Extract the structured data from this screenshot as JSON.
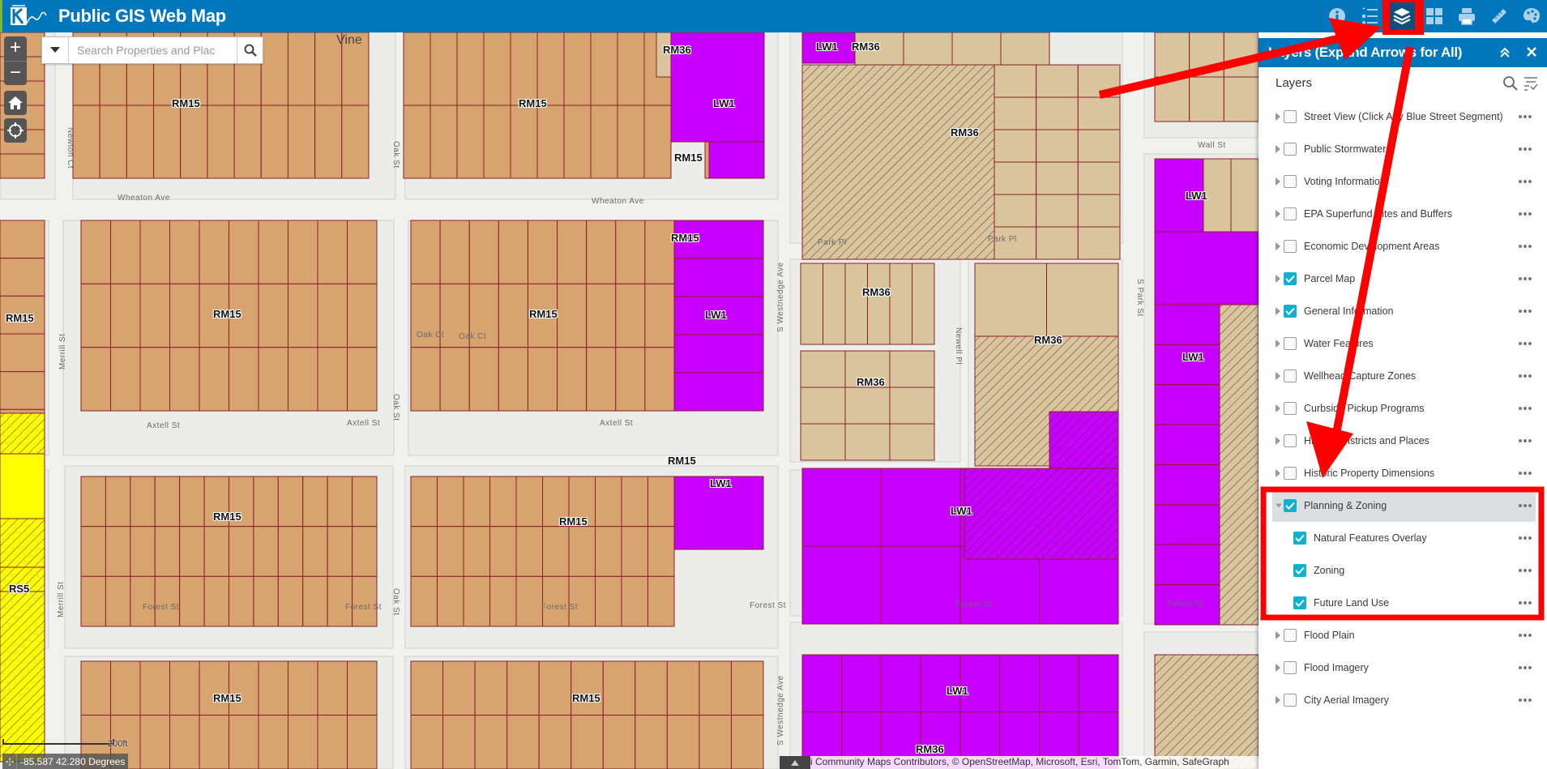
{
  "header": {
    "app_title": "Public GIS Web Map",
    "logo": "city-logo",
    "tools": [
      {
        "name": "info",
        "icon": "info-icon",
        "active": false
      },
      {
        "name": "legend",
        "icon": "legend-list-icon",
        "active": false
      },
      {
        "name": "layers",
        "icon": "layers-icon",
        "active": true
      },
      {
        "name": "basemap-gallery",
        "icon": "grid-icon",
        "active": false
      },
      {
        "name": "print",
        "icon": "printer-icon",
        "active": false
      },
      {
        "name": "measure",
        "icon": "ruler-icon",
        "active": false
      },
      {
        "name": "draw",
        "icon": "palette-icon",
        "active": false
      }
    ]
  },
  "search": {
    "placeholder": "Search Properties and Plac",
    "value": ""
  },
  "map_controls": {
    "zoom_in": "+",
    "zoom_out": "−"
  },
  "map": {
    "place_labels": [
      "Vine"
    ],
    "streets": {
      "wheaton_ave": "Wheaton Ave",
      "park_pl": "Park Pl",
      "axtell_st": "Axtell St",
      "forest_st": "Forest St",
      "wall_st": "Wall St",
      "oak_ct": "Oak Ct",
      "newton_ct": "Newton Ct",
      "merrill_st": "Merrill St",
      "oak_st": "Oak St",
      "s_westnedge_ave": "S Westnedge Ave",
      "newell_pl": "Newell Pl",
      "s_park_st": "S Park St"
    },
    "zones": {
      "rm15": "RM15",
      "rm36": "RM36",
      "lw1": "LW1",
      "rs5": "RS5"
    },
    "zone_colors": {
      "RM15": "#d7a46f",
      "RM36": "#d9c49e",
      "LW1": "#c800ff",
      "RS5": "#ffff00"
    }
  },
  "status": {
    "scale_label": "200ft",
    "coordinates": "-85.587 42.280 Degrees",
    "attribution": "Esri Community Maps Contributors, © OpenStreetMap, Microsoft, Esri, TomTom, Garmin, SafeGraph"
  },
  "layers_panel": {
    "title": "Layers (Expand Arrows for All)",
    "heading": "Layers",
    "layers": [
      {
        "label": "Street View (Click Any Blue Street Segment)",
        "checked": false,
        "expanded": false
      },
      {
        "label": "Public Stormwater",
        "checked": false,
        "expanded": false
      },
      {
        "label": "Voting Information",
        "checked": false,
        "expanded": false
      },
      {
        "label": "EPA Superfund Sites and Buffers",
        "checked": false,
        "expanded": false
      },
      {
        "label": "Economic Development Areas",
        "checked": false,
        "expanded": false
      },
      {
        "label": "Parcel Map",
        "checked": true,
        "expanded": false
      },
      {
        "label": "General Information",
        "checked": true,
        "expanded": false
      },
      {
        "label": "Water Features",
        "checked": false,
        "expanded": false
      },
      {
        "label": "Wellhead Capture Zones",
        "checked": false,
        "expanded": false
      },
      {
        "label": "Curbside Pickup Programs",
        "checked": false,
        "expanded": false
      },
      {
        "label": "Historic Districts and Places",
        "checked": false,
        "expanded": false
      },
      {
        "label": "Historic Property Dimensions",
        "checked": false,
        "expanded": false
      },
      {
        "label": "Planning & Zoning",
        "checked": true,
        "expanded": true,
        "selected": true,
        "children": [
          {
            "label": "Natural Features Overlay",
            "checked": true
          },
          {
            "label": "Zoning",
            "checked": true
          },
          {
            "label": "Future Land Use",
            "checked": true
          }
        ]
      },
      {
        "label": "Flood Plain",
        "checked": false,
        "expanded": false
      },
      {
        "label": "Flood Imagery",
        "checked": false,
        "expanded": false
      },
      {
        "label": "City Aerial Imagery",
        "checked": false,
        "expanded": false
      }
    ]
  },
  "colors": {
    "header_bg": "#0077bd",
    "checkbox_checked": "#10b0cf",
    "annotation_red": "#ff0000"
  }
}
